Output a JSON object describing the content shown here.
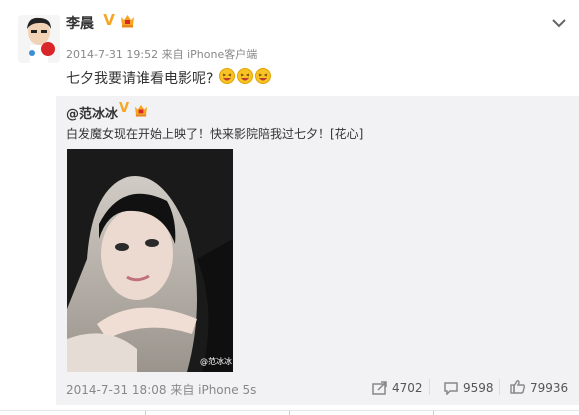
{
  "post": {
    "author": "李晨",
    "timestamp_source": "2014-7-31 19:52 来自 iPhone客户端",
    "content": "七夕我要请谁看电影呢?"
  },
  "repost": {
    "author": "@范冰冰",
    "text": "白发魔女现在开始上映了！快来影院陪我过七夕！[花心]",
    "watermark": "@范冰冰",
    "timestamp_source": "2014-7-31 18:08 来自 iPhone 5s",
    "stats": {
      "forward": "4702",
      "comment": "9598",
      "like": "79936"
    }
  },
  "icons": {
    "verified": "verified-v-icon",
    "vip": "vip-crown-icon",
    "expand": "chevron-down-icon",
    "forward": "forward-icon",
    "comment": "comment-icon",
    "like": "thumbs-up-icon",
    "emoji": "laughing-emoji-icon"
  },
  "colors": {
    "verified": "#f6a623",
    "repost_bg": "#f2f2f5",
    "meta_text": "#888888"
  }
}
